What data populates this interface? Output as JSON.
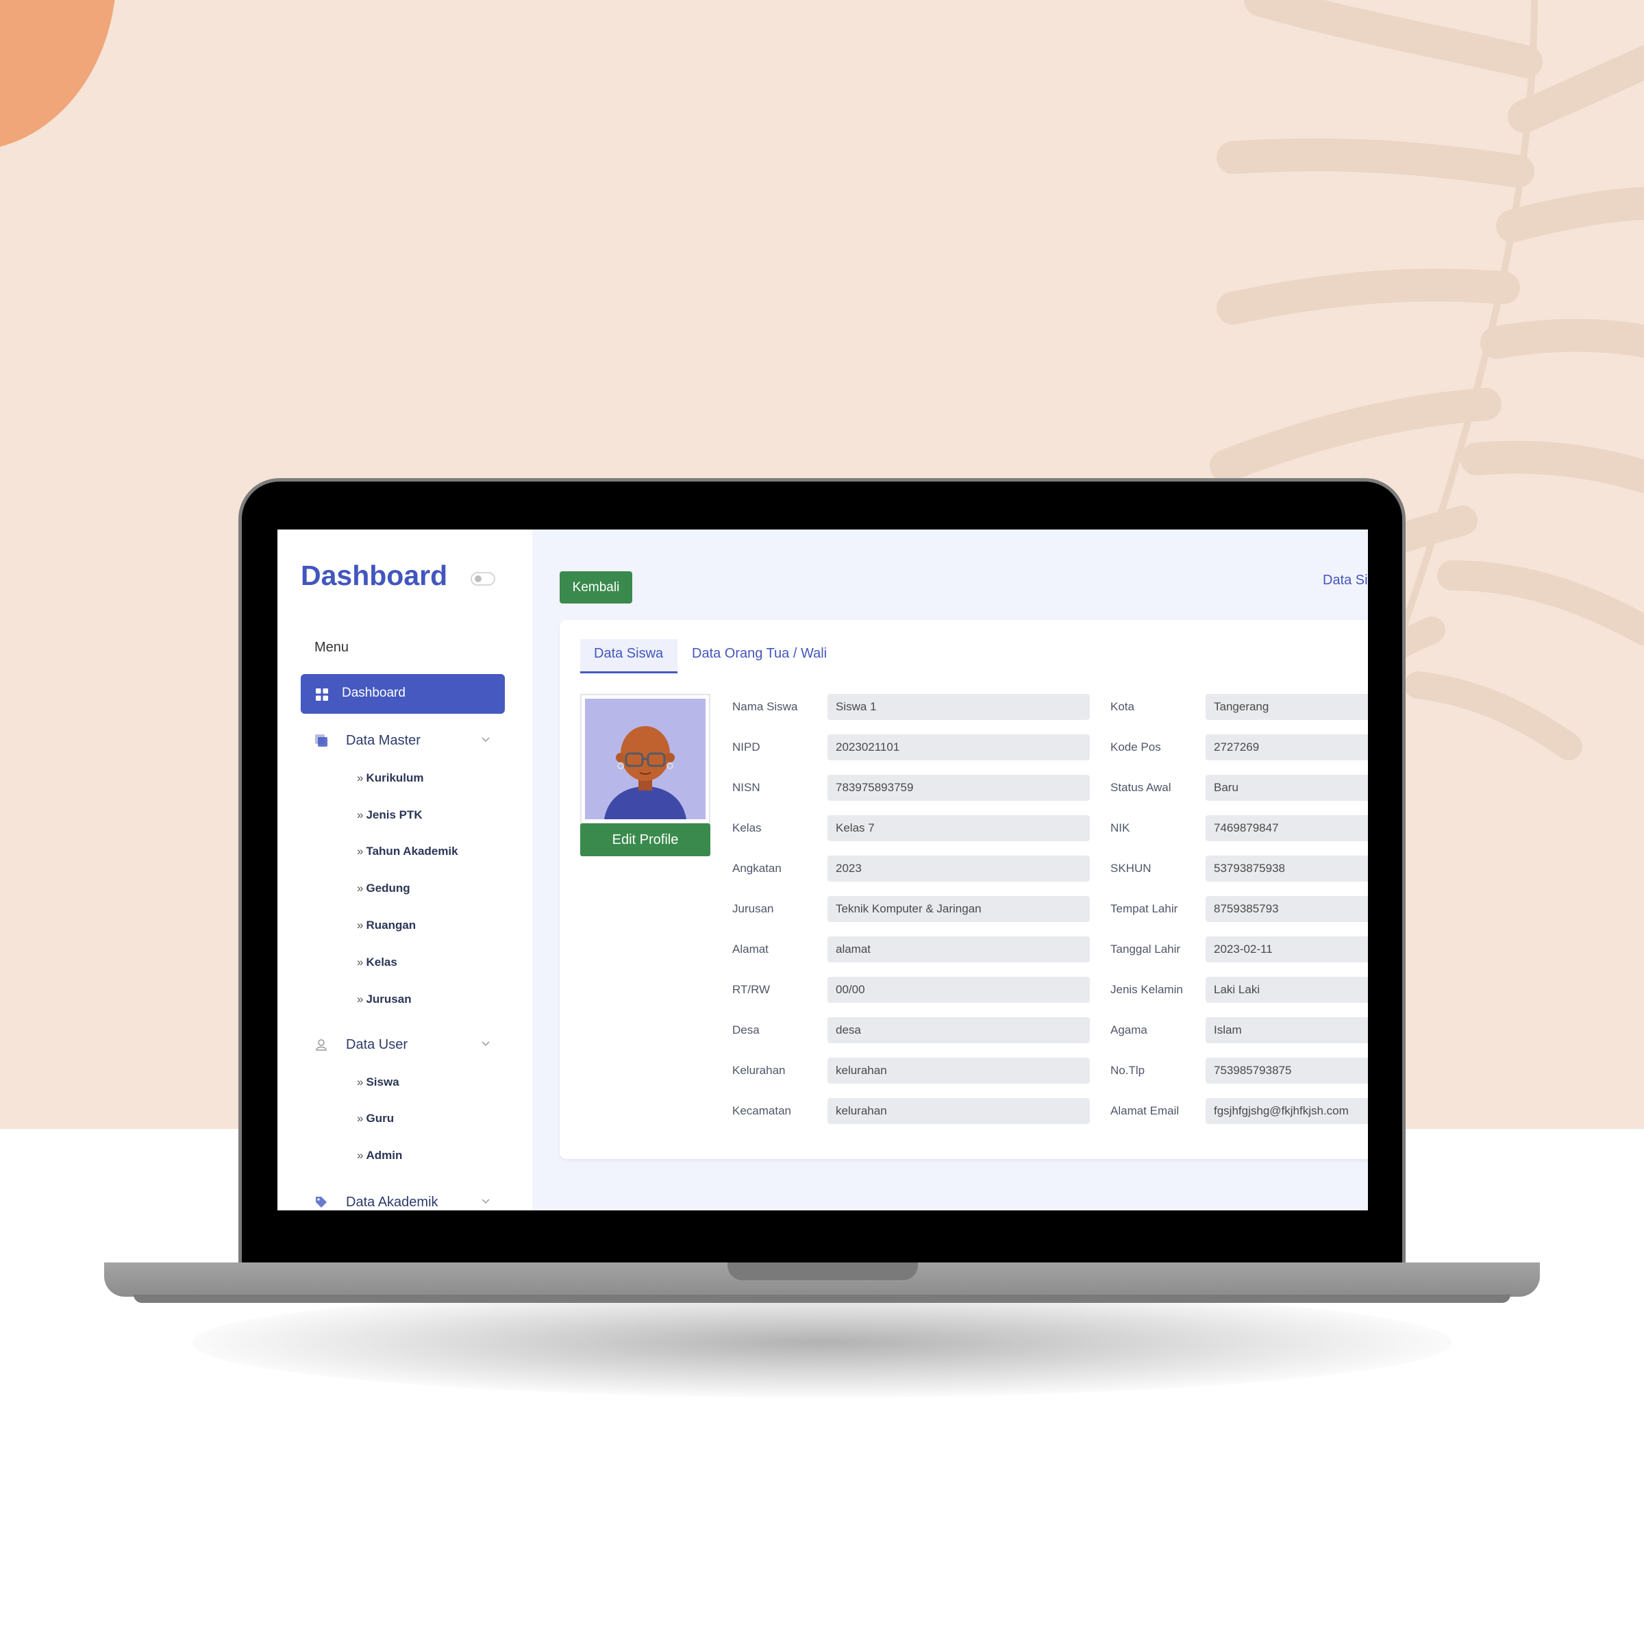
{
  "app": {
    "brand": "Dashboard",
    "menu_title": "Menu",
    "accent_color": "#4659c1",
    "success_color": "#3a8a4d"
  },
  "sidebar": {
    "active": {
      "label": "Dashboard",
      "icon": "grid-icon"
    },
    "groups": [
      {
        "label": "Data Master",
        "icon": "database-icon",
        "items": [
          "Kurikulum",
          "Jenis PTK",
          "Tahun Akademik",
          "Gedung",
          "Ruangan",
          "Kelas",
          "Jurusan"
        ]
      },
      {
        "label": "Data User",
        "icon": "user-icon",
        "items": [
          "Siswa",
          "Guru",
          "Admin"
        ]
      },
      {
        "label": "Data Akademik",
        "icon": "tag-icon",
        "items": []
      }
    ]
  },
  "header": {
    "back_label": "Kembali",
    "breadcrumb": "Data Si"
  },
  "tabs": [
    {
      "label": "Data Siswa",
      "active": true
    },
    {
      "label": "Data Orang Tua / Wali",
      "active": false
    }
  ],
  "profile": {
    "edit_label": "Edit Profile",
    "avatar": "avatar-illustration"
  },
  "fields_left": [
    {
      "label": "Nama Siswa",
      "value": "Siswa 1"
    },
    {
      "label": "NIPD",
      "value": "2023021101"
    },
    {
      "label": "NISN",
      "value": "783975893759"
    },
    {
      "label": "Kelas",
      "value": "Kelas 7"
    },
    {
      "label": "Angkatan",
      "value": "2023"
    },
    {
      "label": "Jurusan",
      "value": "Teknik Komputer & Jaringan"
    },
    {
      "label": "Alamat",
      "value": "alamat"
    },
    {
      "label": "RT/RW",
      "value": "00/00"
    },
    {
      "label": "Desa",
      "value": "desa"
    },
    {
      "label": "Kelurahan",
      "value": "kelurahan"
    },
    {
      "label": "Kecamatan",
      "value": "kelurahan"
    }
  ],
  "fields_right": [
    {
      "label": "Kota",
      "value": "Tangerang"
    },
    {
      "label": "Kode Pos",
      "value": "2727269"
    },
    {
      "label": "Status Awal",
      "value": "Baru"
    },
    {
      "label": "NIK",
      "value": "7469879847"
    },
    {
      "label": "SKHUN",
      "value": "53793875938"
    },
    {
      "label": "Tempat Lahir",
      "value": "8759385793"
    },
    {
      "label": "Tanggal Lahir",
      "value": "2023-02-11"
    },
    {
      "label": "Jenis Kelamin",
      "value": "Laki Laki"
    },
    {
      "label": "Agama",
      "value": "Islam"
    },
    {
      "label": "No.Tlp",
      "value": "753985793875"
    },
    {
      "label": "Alamat Email",
      "value": "fgsjhfgjshg@fkjhfkjsh.com"
    }
  ]
}
